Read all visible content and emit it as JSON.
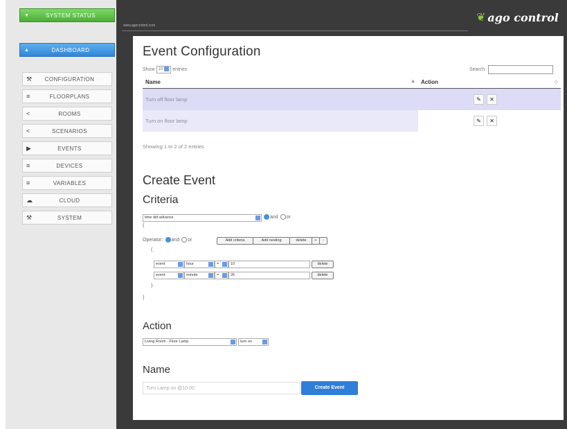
{
  "sidebar": {
    "status_label": "SYSTEM STATUS",
    "dashboard_label": "DASHBOARD",
    "items": [
      {
        "label": "CONFIGURATION",
        "icon": "wrench-icon",
        "glyph": "⚒"
      },
      {
        "label": "FLOORPLANS",
        "icon": "list-icon",
        "glyph": "≡"
      },
      {
        "label": "ROOMS",
        "icon": "share-icon",
        "glyph": "<"
      },
      {
        "label": "SCENARIOS",
        "icon": "share-icon",
        "glyph": "<"
      },
      {
        "label": "EVENTS",
        "icon": "bullhorn-icon",
        "glyph": "▶"
      },
      {
        "label": "DEVICES",
        "icon": "sliders-icon",
        "glyph": "≡"
      },
      {
        "label": "VARIABLES",
        "icon": "sliders-icon",
        "glyph": "≡"
      },
      {
        "label": "CLOUD",
        "icon": "cloud-icon",
        "glyph": "☁"
      },
      {
        "label": "SYSTEM",
        "icon": "wrench-icon",
        "glyph": "⚒"
      }
    ]
  },
  "header": {
    "url": "www.agocontrol.com",
    "logo_text": "ago control"
  },
  "event_config": {
    "title": "Event Configuration",
    "show_prefix": "Show",
    "show_value": "10",
    "show_suffix": "entries",
    "search_label": "Search:",
    "columns": [
      "Name",
      "Action"
    ],
    "rows": [
      {
        "name": "Turn off floor lamp"
      },
      {
        "name": "Turn on floor lamp"
      }
    ],
    "info": "Showing 1 to 2 of 2 entries"
  },
  "create_event": {
    "title": "Create Event",
    "criteria_title": "Criteria",
    "trigger_value": "time did advance",
    "and_label": "and",
    "or_label": "or",
    "open_brace": "{",
    "close_brace": "}",
    "open_paren": "(",
    "close_paren": ")",
    "operator_label": "Operator:",
    "buttons": [
      "Add criteria",
      "Add nesting",
      "delete",
      "+",
      "-"
    ],
    "conditions": [
      {
        "source": "event",
        "field": "hour",
        "op": "=",
        "value": "10",
        "delete": "delete"
      },
      {
        "source": "event",
        "field": "minute",
        "op": "=",
        "value": "26",
        "delete": "delete"
      }
    ],
    "action_title": "Action",
    "action_device": "Living Room - Floor Lamp",
    "action_command": "turn on",
    "name_title": "Name",
    "name_placeholder": "Turn Lamp on @10:00",
    "create_button": "Create Event"
  },
  "colors": {
    "status_green": "#4cae36",
    "dashboard_blue": "#2f86d6",
    "row_highlight": "#dcdcf6",
    "create_button": "#2f7ed8"
  }
}
